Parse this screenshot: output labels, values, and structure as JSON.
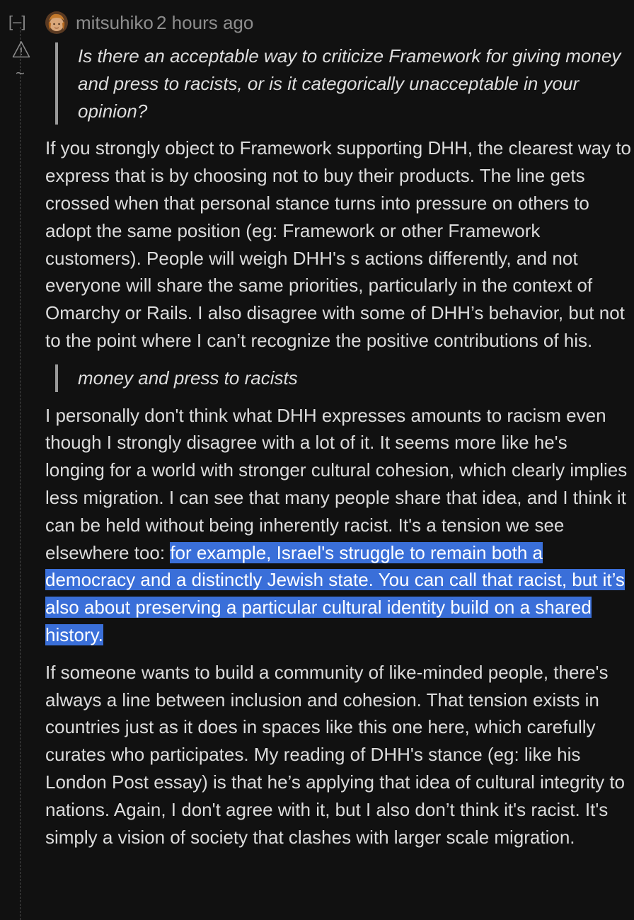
{
  "gutter": {
    "collapse_label": "[–]",
    "vote_label": "~"
  },
  "comment": {
    "author": "mitsuhiko",
    "time": "2 hours ago",
    "quote1": "Is there an acceptable way to criticize Framework for giving money and press to racists, or is it categorically unacceptable in your opinion?",
    "para1": "If you strongly object to Framework supporting DHH, the clearest way to express that is by choosing not to buy their products. The line gets crossed when that personal stance turns into pressure on others to adopt the same position (eg: Framework or other Framework customers). People will weigh DHH's s actions differently, and not everyone will share the same priorities, particularly in the context of Omarchy or Rails. I also disagree with some of DHH’s behavior, but not to the point where I can’t recognize the positive contributions of his.",
    "quote2": "money and press to racists",
    "para2_before": "I personally don't think what DHH expresses amounts to racism even though I strongly disagree with a lot of it. It seems more like he's longing for a world with stronger cultural cohesion, which clearly implies less migration. I can see that many people share that idea, and I think it can be held without being inherently racist. It's a tension we see elsewhere too: ",
    "para2_highlight": "for example, Israel's struggle to remain both a democracy and a distinctly Jewish state. You can call that racist, but it’s also about preserving a particular cultural identity build on a shared history.",
    "para3": "If someone wants to build a community of like-minded people, there's always a line between inclusion and cohesion. That tension exists in countries just as it does in spaces like this one here, which carefully curates who participates. My reading of DHH's stance (eg: like his London Post essay) is that he’s applying that idea of cultural integrity to nations. Again, I don't agree with it, but I also don’t think it's racist. It's simply a vision of society that clashes with larger scale migration."
  },
  "colors": {
    "background": "#111111",
    "text": "#dcdcdc",
    "meta": "#8d8d8d",
    "selection": "#3a6fd9"
  },
  "icons": {
    "flag": "warning-triangle-icon",
    "avatar": "user-avatar"
  }
}
